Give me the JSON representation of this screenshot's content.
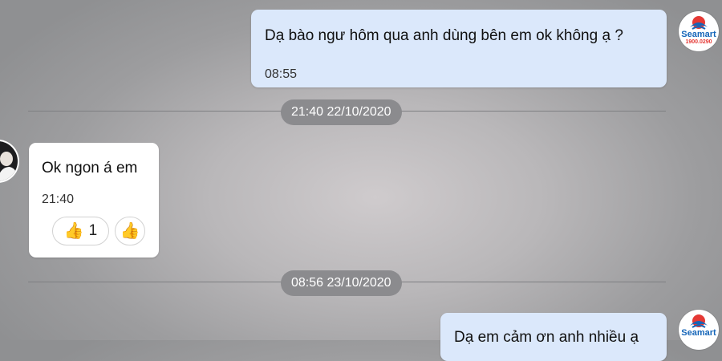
{
  "messages": [
    {
      "text": "Dạ bào ngư hôm qua anh dùng bên em ok không ạ ?",
      "time": "08:55"
    },
    {
      "text": "Ok ngon á em",
      "time": "21:40",
      "reaction": {
        "icon": "thumbs-up-icon",
        "count": "1"
      }
    },
    {
      "text": "Dạ em cảm ơn anh nhiều ạ"
    }
  ],
  "dates": [
    "21:40 22/10/2020",
    "08:56 23/10/2020"
  ],
  "brand": {
    "name": "Seamart",
    "phone": "1900.0290"
  },
  "colors": {
    "outgoing_bubble": "#dbe8fb",
    "incoming_bubble": "#ffffff",
    "date_pill": "#8b8b8e",
    "brand_blue": "#1565b8",
    "brand_red": "#e53935"
  }
}
